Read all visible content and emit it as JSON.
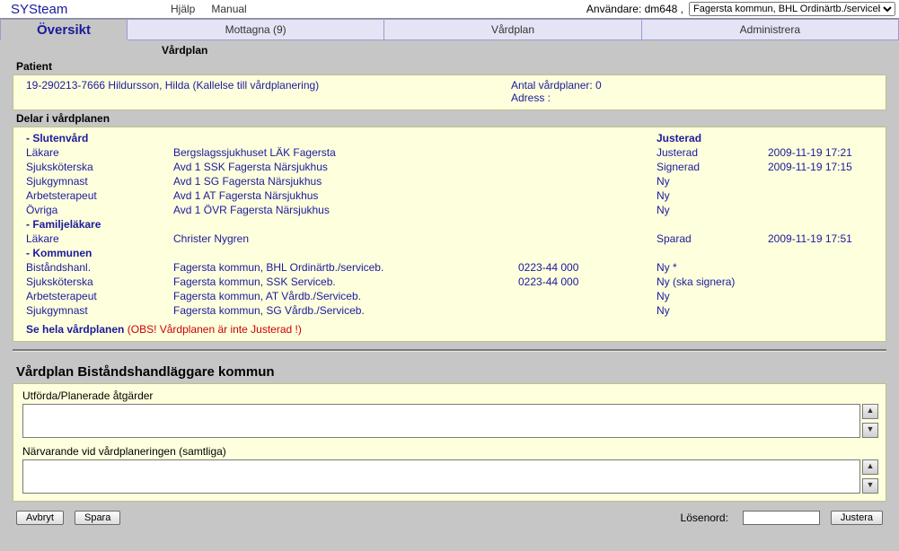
{
  "header": {
    "brand": "SYSteam",
    "help": "Hjälp",
    "manual": "Manual",
    "user_label": "Användare: dm648 ,",
    "org_selected": "Fagersta kommun, BHL Ordinärtb./serviceb."
  },
  "tabs": {
    "overview": "Översikt",
    "received": "Mottagna (9)",
    "careplan": "Vårdplan",
    "admin": "Administrera"
  },
  "sub_header": "Vårdplan",
  "patient_section_label": "Patient",
  "patient": {
    "line": "19-290213-7666  Hildursson, Hilda  (Kallelse till vårdplanering)",
    "plans_label": "Antal vårdplaner:  0",
    "address_label": "Adress :"
  },
  "parts_label": "Delar i vårdplanen",
  "status_header": "Justerad",
  "groups": [
    {
      "name": "Slutenvård",
      "rows": [
        {
          "role": "Läkare",
          "unit": "Bergslagssjukhuset LÄK Fagersta",
          "phone": "",
          "status": "Justerad",
          "date": "2009-11-19 17:21"
        },
        {
          "role": "Sjuksköterska",
          "unit": "Avd 1 SSK Fagersta Närsjukhus",
          "phone": "",
          "status": "Signerad",
          "date": "2009-11-19 17:15"
        },
        {
          "role": "Sjukgymnast",
          "unit": "Avd 1 SG Fagersta Närsjukhus",
          "phone": "",
          "status": "Ny",
          "date": ""
        },
        {
          "role": "Arbetsterapeut",
          "unit": "Avd 1 AT Fagersta Närsjukhus",
          "phone": "",
          "status": "Ny",
          "date": ""
        },
        {
          "role": "Övriga",
          "unit": "Avd 1 ÖVR Fagersta Närsjukhus",
          "phone": "",
          "status": "Ny",
          "date": ""
        }
      ]
    },
    {
      "name": "Familjeläkare",
      "rows": [
        {
          "role": "Läkare",
          "unit": "Christer Nygren",
          "phone": "",
          "status": "Sparad",
          "date": "2009-11-19 17:51"
        }
      ]
    },
    {
      "name": "Kommunen",
      "rows": [
        {
          "role": "Biståndshanl.",
          "unit": "Fagersta kommun, BHL Ordinärtb./serviceb.",
          "phone": "0223-44 000",
          "status": "Ny *",
          "date": ""
        },
        {
          "role": "Sjuksköterska",
          "unit": "Fagersta kommun, SSK Serviceb.",
          "phone": "0223-44 000",
          "status": "Ny (ska signera)",
          "date": ""
        },
        {
          "role": "Arbetsterapeut",
          "unit": "Fagersta kommun, AT Vårdb./Serviceb.",
          "phone": "",
          "status": "Ny",
          "date": ""
        },
        {
          "role": "Sjukgymnast",
          "unit": "Fagersta kommun, SG Vårdb./Serviceb.",
          "phone": "",
          "status": "Ny",
          "date": ""
        }
      ]
    }
  ],
  "see_all": {
    "label": "Se hela vårdplanen",
    "warning": "(OBS! Vårdplanen är inte Justerad !)"
  },
  "form": {
    "title": "Vårdplan Biståndshandläggare kommun",
    "field1_label": "Utförda/Planerade åtgärder",
    "field1_value": "",
    "field2_label": "Närvarande vid vårdplaneringen (samtliga)",
    "field2_value": ""
  },
  "buttons": {
    "cancel": "Avbryt",
    "save": "Spara",
    "password_label": "Lösenord:",
    "password_value": "",
    "adjust": "Justera"
  }
}
